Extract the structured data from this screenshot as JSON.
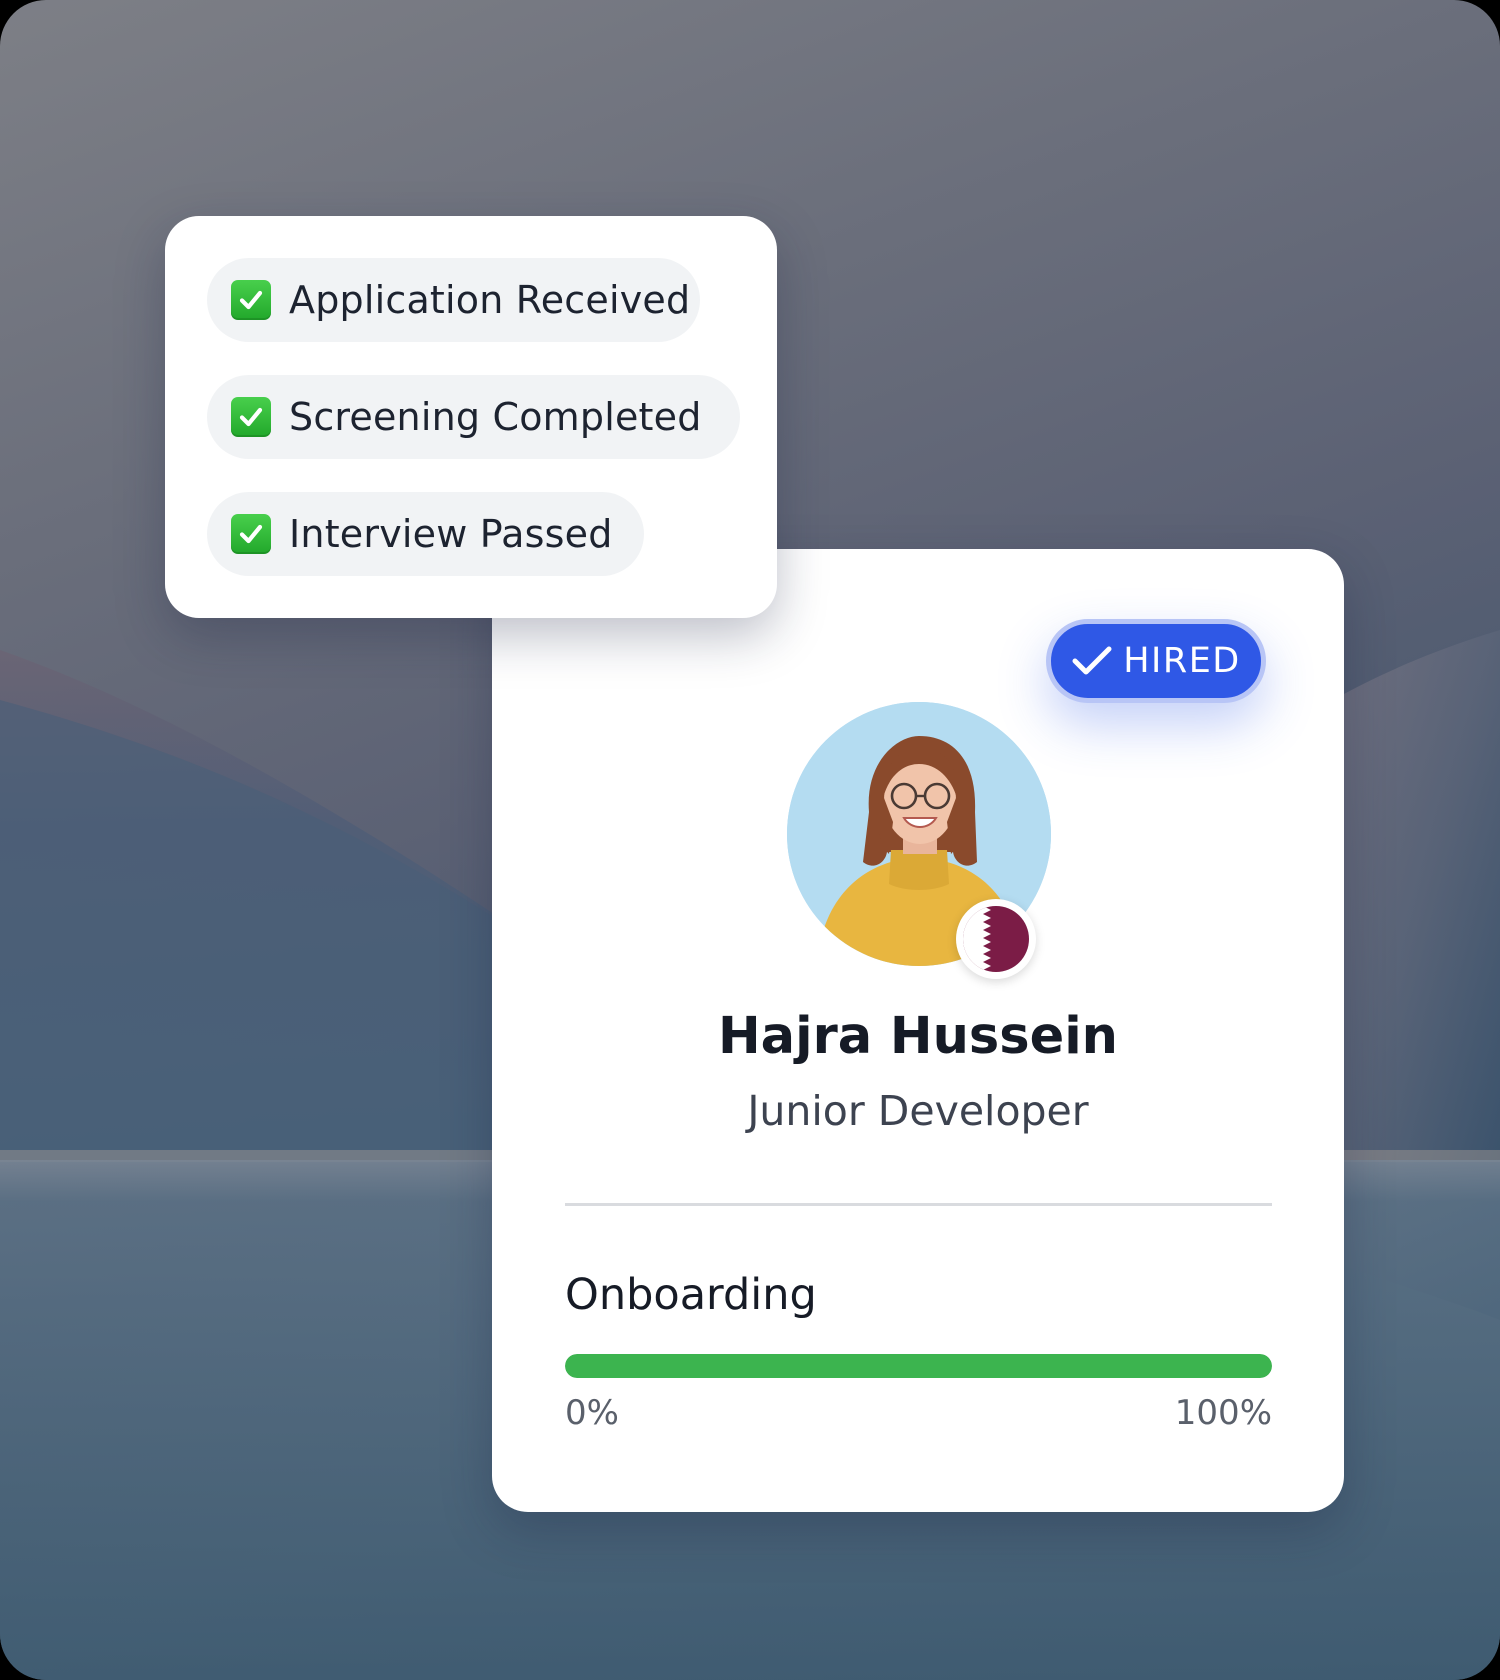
{
  "checklist": {
    "items": [
      {
        "label": "Application Received",
        "icon": "checkbox-checked-icon"
      },
      {
        "label": "Screening Completed",
        "icon": "checkbox-checked-icon"
      },
      {
        "label": "Interview Passed",
        "icon": "checkbox-checked-icon"
      }
    ]
  },
  "profile": {
    "status_badge": "HIRED",
    "name": "Hajra Hussein",
    "role": "Junior Developer",
    "avatar_icon": "avatar-photo",
    "flag_icon": "qatar-flag-icon",
    "onboarding": {
      "title": "Onboarding",
      "progress_percent": 100,
      "min_label": "0%",
      "max_label": "100%"
    }
  },
  "colors": {
    "accent_blue": "#2f58e6",
    "progress_green": "#3cb44f",
    "check_green": "#22a82b",
    "flag_maroon": "#7b1c46"
  }
}
